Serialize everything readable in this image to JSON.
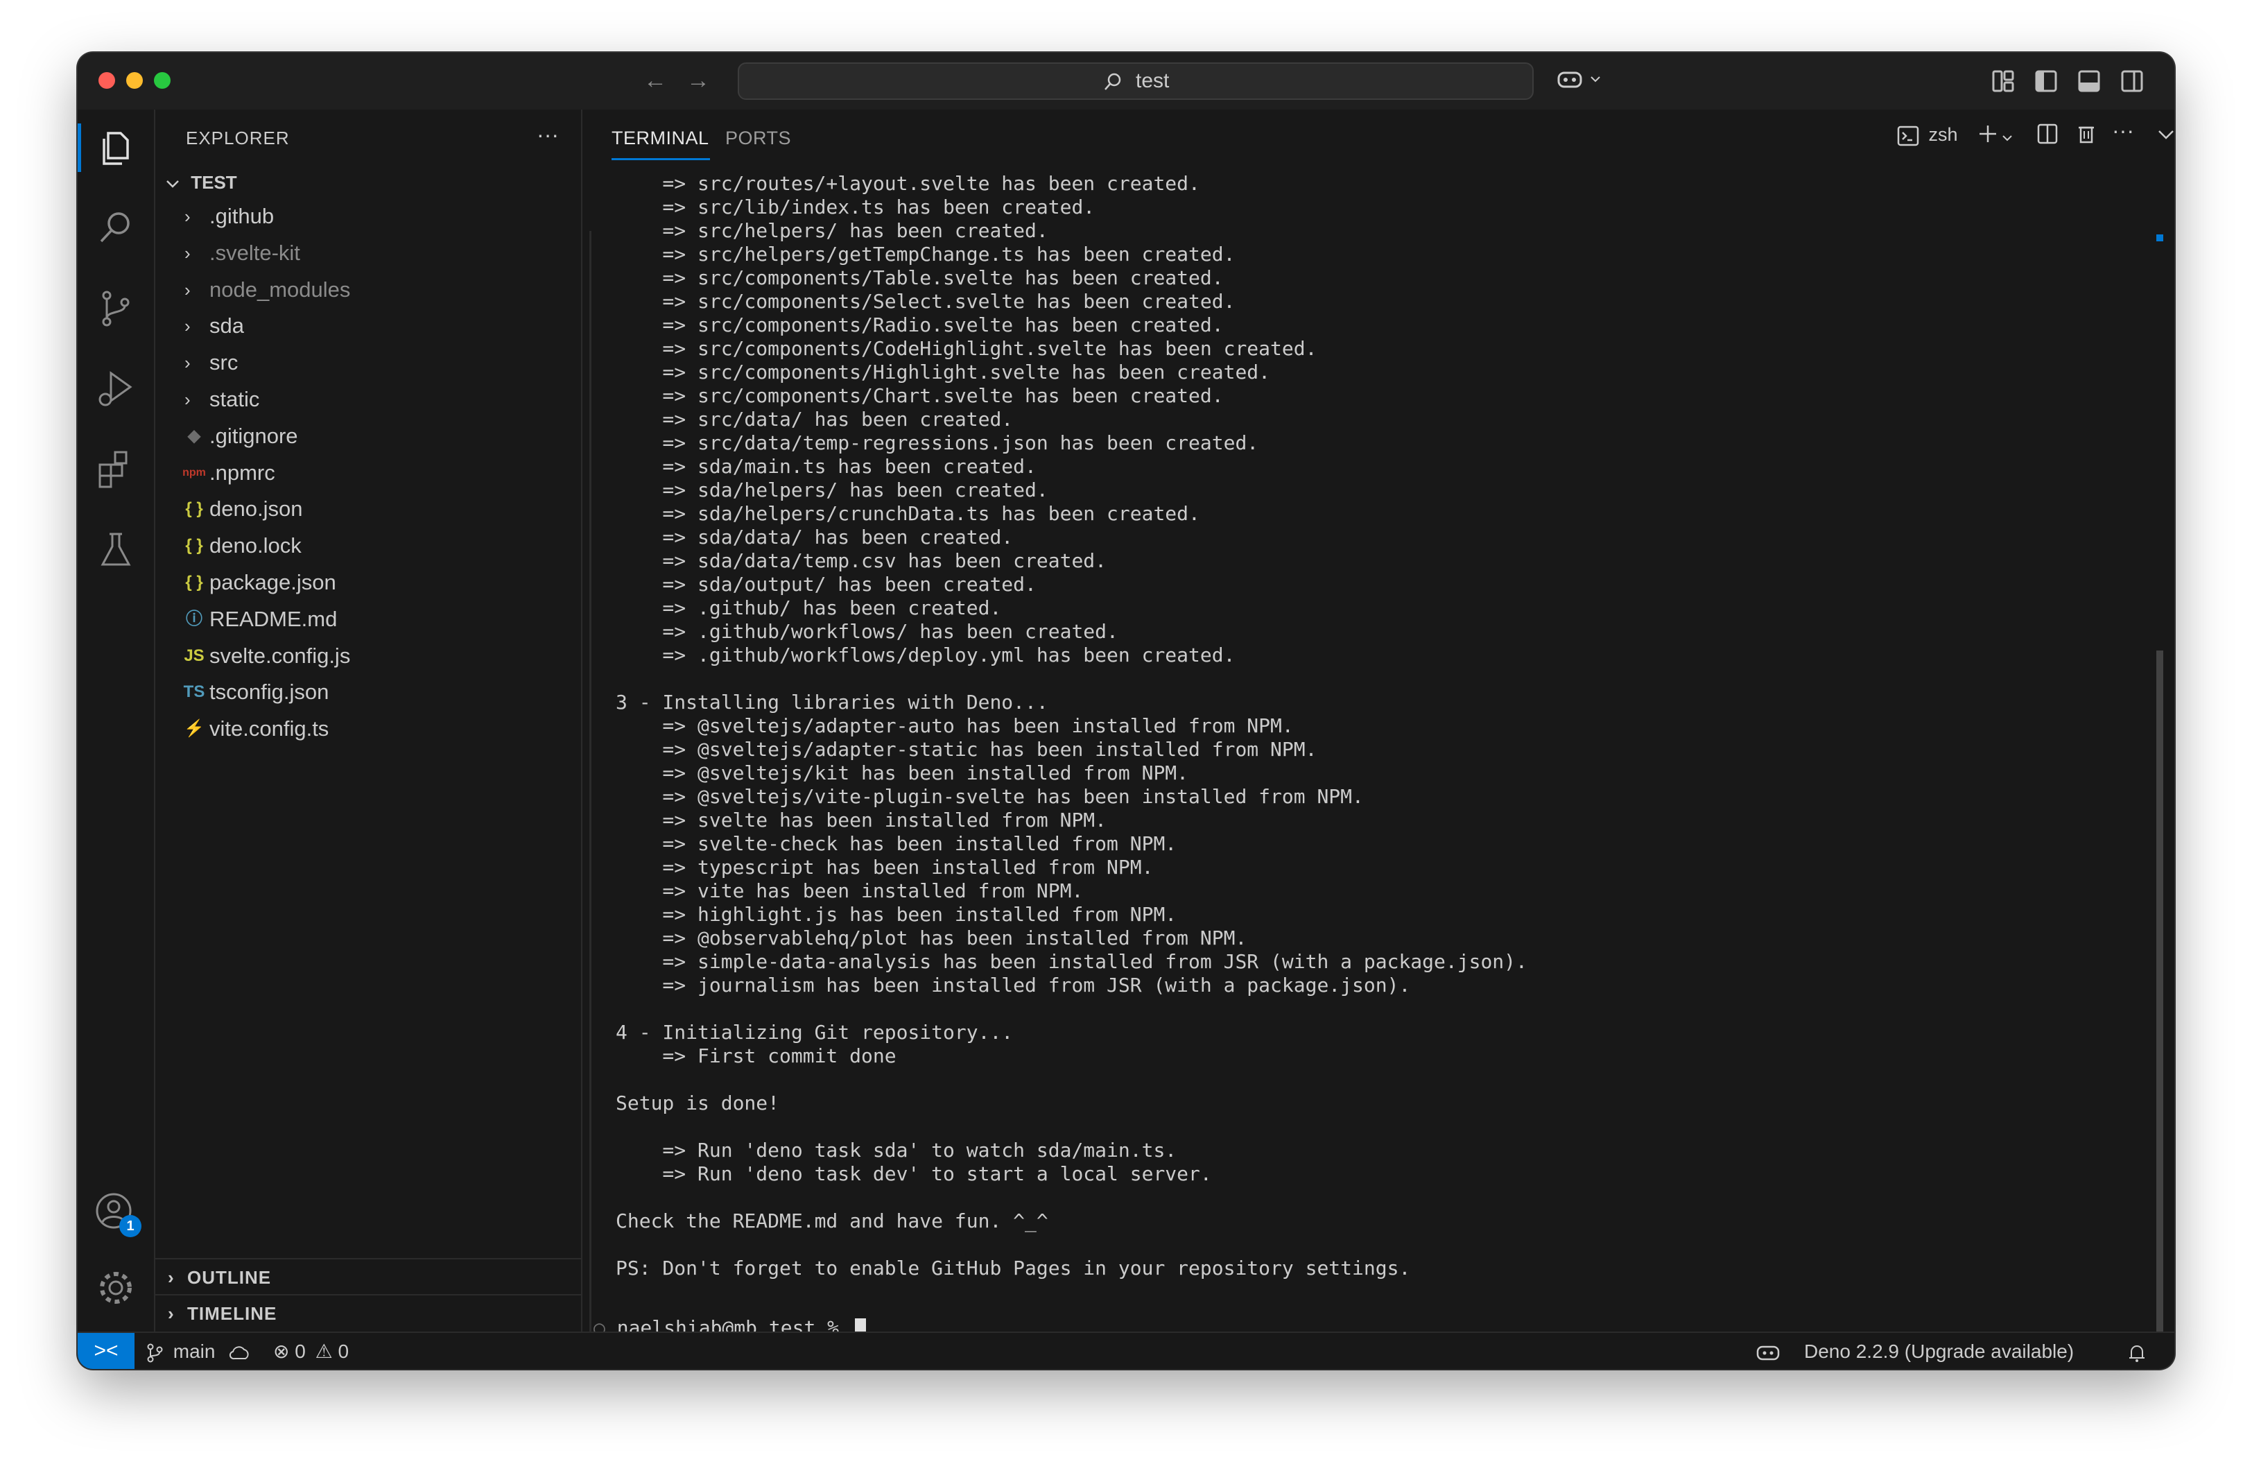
{
  "title_bar": {
    "search_text": "test",
    "back_arrow": "←",
    "forward_arrow": "→",
    "copilot_icon": "copilot-icon",
    "layout_icons": [
      "customize-layout-icon",
      "toggle-primary-sidebar-icon",
      "toggle-panel-icon",
      "toggle-secondary-sidebar-icon"
    ]
  },
  "activity_bar": {
    "items": [
      "explorer-icon",
      "search-icon",
      "source-control-icon",
      "run-debug-icon",
      "extensions-icon",
      "testing-icon"
    ],
    "accounts_badge": "1"
  },
  "explorer": {
    "header": "EXPLORER",
    "more": "···",
    "root": "TEST",
    "items": [
      {
        "label": ".github",
        "type": "folder"
      },
      {
        "label": ".svelte-kit",
        "type": "folder",
        "dim": true
      },
      {
        "label": "node_modules",
        "type": "folder",
        "dim": true
      },
      {
        "label": "sda",
        "type": "folder"
      },
      {
        "label": "src",
        "type": "folder"
      },
      {
        "label": "static",
        "type": "folder"
      },
      {
        "label": ".gitignore",
        "type": "file",
        "icon": "◆",
        "icon_color": "#6d6d6d"
      },
      {
        "label": ".npmrc",
        "type": "file",
        "icon": "npm",
        "icon_color": "#c0392b"
      },
      {
        "label": "deno.json",
        "type": "file",
        "icon": "{ }",
        "icon_color": "#cbcb41"
      },
      {
        "label": "deno.lock",
        "type": "file",
        "icon": "{ }",
        "icon_color": "#cbcb41"
      },
      {
        "label": "package.json",
        "type": "file",
        "icon": "{ }",
        "icon_color": "#cbcb41"
      },
      {
        "label": "README.md",
        "type": "file",
        "icon": "ⓘ",
        "icon_color": "#519aba"
      },
      {
        "label": "svelte.config.js",
        "type": "file",
        "icon": "JS",
        "icon_color": "#cbcb41"
      },
      {
        "label": "tsconfig.json",
        "type": "file",
        "icon": "TS",
        "icon_color": "#519aba"
      },
      {
        "label": "vite.config.ts",
        "type": "file",
        "icon": "⚡",
        "icon_color": "#f1c40f"
      }
    ],
    "outline": "OUTLINE",
    "timeline": "TIMELINE"
  },
  "panel": {
    "tabs": [
      {
        "label": "TERMINAL",
        "active": true
      },
      {
        "label": "PORTS",
        "active": false
      }
    ],
    "shell": "zsh",
    "terminal_lines": [
      "    => src/routes/+layout.svelte has been created.",
      "    => src/lib/index.ts has been created.",
      "    => src/helpers/ has been created.",
      "    => src/helpers/getTempChange.ts has been created.",
      "    => src/components/Table.svelte has been created.",
      "    => src/components/Select.svelte has been created.",
      "    => src/components/Radio.svelte has been created.",
      "    => src/components/CodeHighlight.svelte has been created.",
      "    => src/components/Highlight.svelte has been created.",
      "    => src/components/Chart.svelte has been created.",
      "    => src/data/ has been created.",
      "    => src/data/temp-regressions.json has been created.",
      "    => sda/main.ts has been created.",
      "    => sda/helpers/ has been created.",
      "    => sda/helpers/crunchData.ts has been created.",
      "    => sda/data/ has been created.",
      "    => sda/data/temp.csv has been created.",
      "    => sda/output/ has been created.",
      "    => .github/ has been created.",
      "    => .github/workflows/ has been created.",
      "    => .github/workflows/deploy.yml has been created.",
      "",
      "3 - Installing libraries with Deno...",
      "    => @sveltejs/adapter-auto has been installed from NPM.",
      "    => @sveltejs/adapter-static has been installed from NPM.",
      "    => @sveltejs/kit has been installed from NPM.",
      "    => @sveltejs/vite-plugin-svelte has been installed from NPM.",
      "    => svelte has been installed from NPM.",
      "    => svelte-check has been installed from NPM.",
      "    => typescript has been installed from NPM.",
      "    => vite has been installed from NPM.",
      "    => highlight.js has been installed from NPM.",
      "    => @observablehq/plot has been installed from NPM.",
      "    => simple-data-analysis has been installed from JSR (with a package.json).",
      "    => journalism has been installed from JSR (with a package.json).",
      "",
      "4 - Initializing Git repository...",
      "    => First commit done",
      "",
      "Setup is done!",
      "",
      "    => Run 'deno task sda' to watch sda/main.ts.",
      "    => Run 'deno task dev' to start a local server.",
      "",
      "Check the README.md and have fun. ^_^",
      "",
      "PS: Don't forget to enable GitHub Pages in your repository settings."
    ],
    "prompt": "naelshiab@mb test % "
  },
  "status_bar": {
    "remote": "><",
    "branch": "main",
    "errors": "0",
    "warnings": "0",
    "deno_status": "Deno 2.2.9 (Upgrade available)"
  },
  "colors": {
    "accent": "#0078d4",
    "background": "#181818"
  }
}
